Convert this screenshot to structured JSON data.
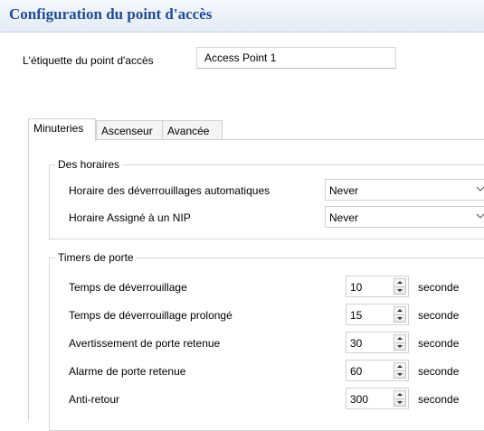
{
  "header": {
    "title": "Configuration du point d'accès"
  },
  "access_point": {
    "label": "L'étiquette du point d'accès",
    "value": "Access Point 1"
  },
  "tabs": [
    {
      "label": "Minuteries",
      "active": true
    },
    {
      "label": "Ascenseur",
      "active": false
    },
    {
      "label": "Avancée",
      "active": false
    }
  ],
  "schedules": {
    "legend": "Des horaires",
    "rows": [
      {
        "label": "Horaire des déverrouillages automatiques",
        "value": "Never"
      },
      {
        "label": "Horaire Assigné à un NIP",
        "value": "Never"
      }
    ]
  },
  "door_timers": {
    "legend": "Timers de porte",
    "unit": "seconde",
    "rows": [
      {
        "label": "Temps de déverrouillage",
        "value": "10"
      },
      {
        "label": "Temps de déverrouillage prolongé",
        "value": "15"
      },
      {
        "label": "Avertissement de porte retenue",
        "value": "30"
      },
      {
        "label": "Alarme de porte retenue",
        "value": "60"
      },
      {
        "label": "Anti-retour",
        "value": "300"
      }
    ]
  },
  "icons": {
    "dropdown": "chevron-down-icon",
    "spinner_up": "arrow-up-icon",
    "spinner_down": "arrow-down-icon"
  },
  "colors": {
    "title": "#1f4a9b",
    "header_bg": "#e3ebf5"
  }
}
